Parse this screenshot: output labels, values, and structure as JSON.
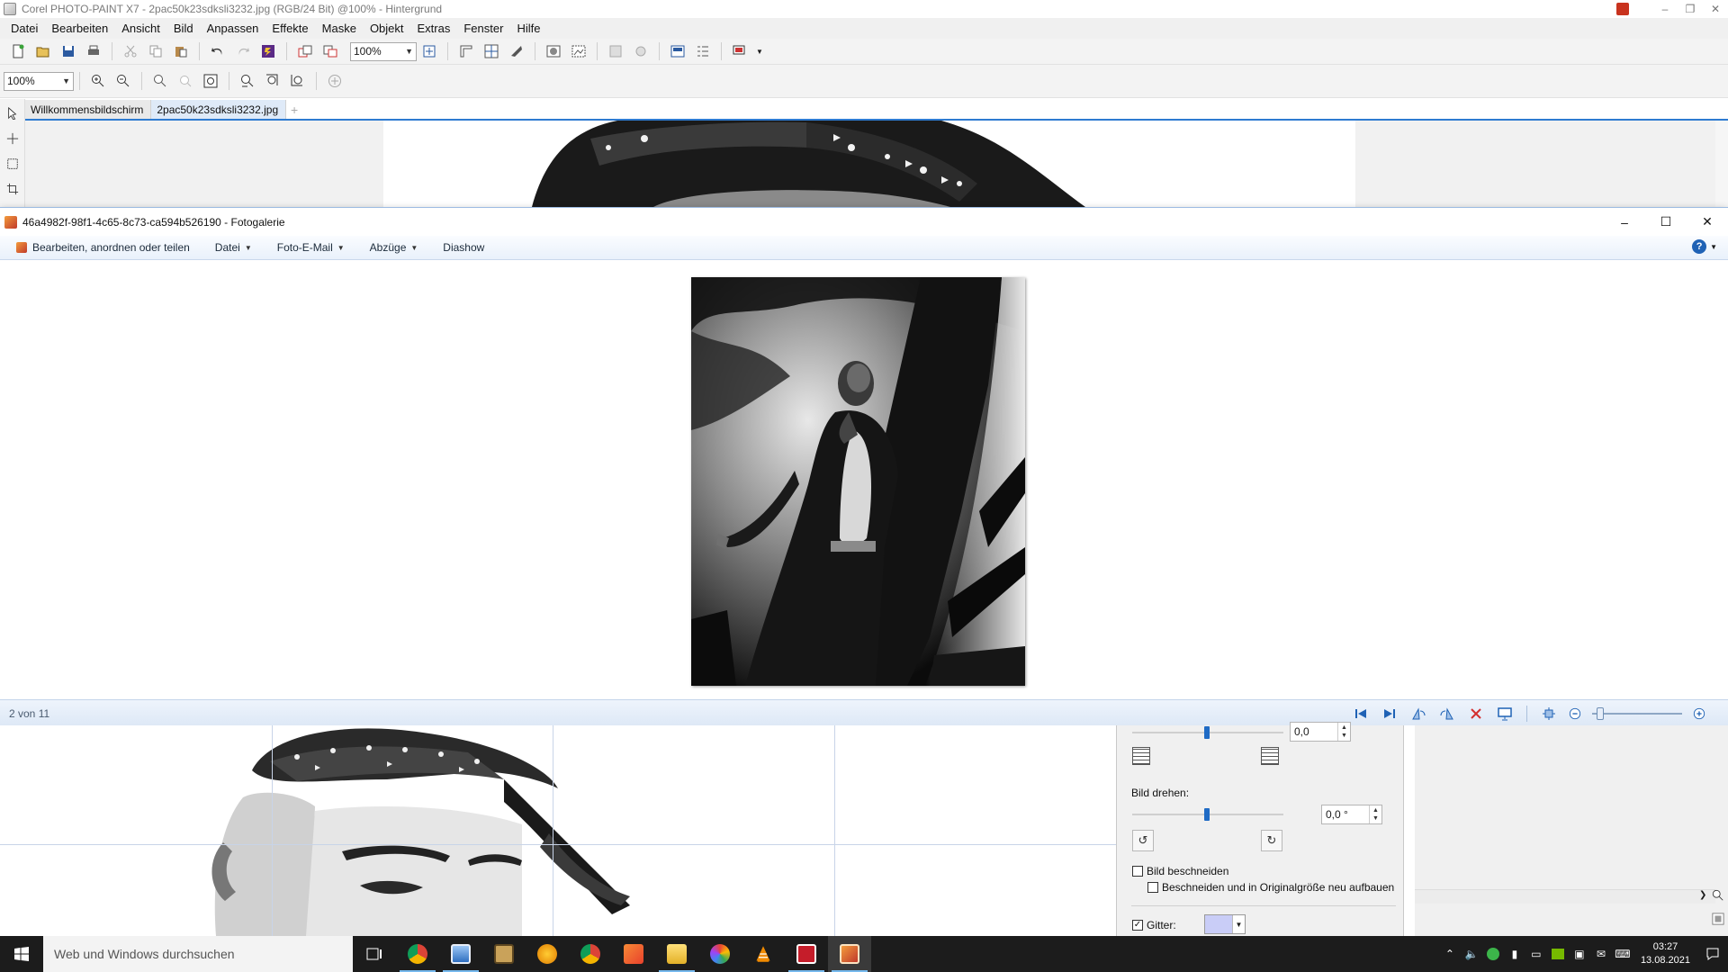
{
  "corel": {
    "title": "Corel PHOTO-PAINT X7 - 2pac50k23sdksli3232.jpg (RGB/24 Bit) @100% - Hintergrund",
    "menu": [
      "Datei",
      "Bearbeiten",
      "Ansicht",
      "Bild",
      "Anpassen",
      "Effekte",
      "Maske",
      "Objekt",
      "Extras",
      "Fenster",
      "Hilfe"
    ],
    "toolbar_zoom_value": "100%",
    "zoombar_value": "100%",
    "tabs": [
      "Willkommensbildschirm",
      "2pac50k23sdksli3232.jpg"
    ],
    "active_tab": 1
  },
  "gallery": {
    "title": "46a4982f-98f1-4c65-8c73-ca594b526190 - Fotogalerie",
    "commands": [
      "Bearbeiten, anordnen oder teilen",
      "Datei",
      "Foto-E-Mail",
      "Abzüge",
      "Diashow"
    ],
    "status": "2 von 11",
    "zoom_level": 0.05,
    "icons": {
      "help": "help-icon",
      "nav": [
        "previous-icon",
        "next-icon",
        "rotate-left-icon",
        "rotate-right-icon",
        "delete-icon",
        "slideshow-icon",
        "fit-to-window-icon",
        "zoom-out-icon",
        "zoom-in-icon"
      ]
    }
  },
  "dialog": {
    "top_spin_value": "0,0",
    "rotate_label": "Bild drehen:",
    "rotate_value": "0,0 °",
    "crop_label": "Bild beschneiden",
    "crop_checked": false,
    "crop_rebuild_label": "Beschneiden und in Originalgröße neu aufbauen",
    "crop_rebuild_checked": false,
    "grid_label": "Gitter:",
    "grid_checked": true,
    "grid_color": "#c9cdf7"
  },
  "taskbar": {
    "search_placeholder": "Web und Windows durchsuchen",
    "time": "03:27",
    "date": "13.08.2021",
    "apps": [
      "task-view-icon",
      "chrome-icon",
      "photo-viewer-icon",
      "camera-app-icon",
      "firefox-icon",
      "chrome-alt-icon",
      "swift-icon",
      "file-explorer-icon",
      "picasa-icon",
      "vlc-icon",
      "media-app-icon",
      "photo-gallery-icon"
    ]
  },
  "colors": {
    "accent": "#2e7bd1",
    "gallery_chrome": "#e9f1fb",
    "taskbar": "#1c1c1c"
  }
}
